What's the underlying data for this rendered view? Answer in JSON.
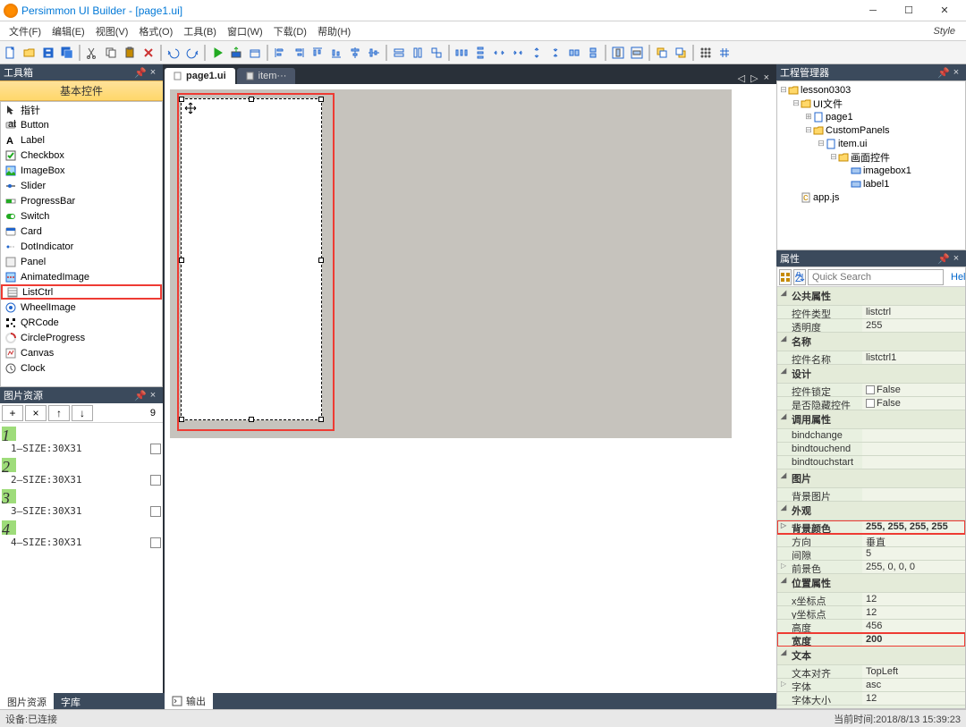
{
  "window": {
    "title": "Persimmon UI Builder - [page1.ui]"
  },
  "menu": [
    "文件(F)",
    "编辑(E)",
    "视图(V)",
    "格式(O)",
    "工具(B)",
    "窗口(W)",
    "下载(D)",
    "帮助(H)"
  ],
  "style_label": "Style",
  "toolbox": {
    "title": "工具箱",
    "section": "基本控件",
    "items": [
      "指针",
      "Button",
      "Label",
      "Checkbox",
      "ImageBox",
      "Slider",
      "ProgressBar",
      "Switch",
      "Card",
      "DotIndicator",
      "Panel",
      "AnimatedImage",
      "ListCtrl",
      "WheelImage",
      "QRCode",
      "CircleProgress",
      "Canvas",
      "Clock"
    ],
    "highlight": "ListCtrl"
  },
  "img_res": {
    "title": "图片资源",
    "count": "9",
    "items": [
      {
        "num": "1",
        "label": "1—SIZE:30X31"
      },
      {
        "num": "2",
        "label": "2—SIZE:30X31"
      },
      {
        "num": "3",
        "label": "3—SIZE:30X31"
      },
      {
        "num": "4",
        "label": "4—SIZE:30X31"
      }
    ],
    "tab_active": "图片资源",
    "tab_other": "字库"
  },
  "doc_tabs": {
    "active": "page1.ui",
    "other": "item···"
  },
  "project": {
    "title": "工程管理器",
    "tree": [
      {
        "depth": 0,
        "exp": "⊟",
        "icon": "folder",
        "label": "lesson0303"
      },
      {
        "depth": 1,
        "exp": "⊟",
        "icon": "folder",
        "label": "UI文件"
      },
      {
        "depth": 2,
        "exp": "⊞",
        "icon": "page",
        "label": "page1"
      },
      {
        "depth": 2,
        "exp": "⊟",
        "icon": "folder",
        "label": "CustomPanels"
      },
      {
        "depth": 3,
        "exp": "⊟",
        "icon": "page",
        "label": "item.ui"
      },
      {
        "depth": 4,
        "exp": "⊟",
        "icon": "folder",
        "label": "画面控件"
      },
      {
        "depth": 5,
        "exp": "",
        "icon": "ctrl",
        "label": "imagebox1"
      },
      {
        "depth": 5,
        "exp": "",
        "icon": "ctrl",
        "label": "label1"
      },
      {
        "depth": 1,
        "exp": "",
        "icon": "js",
        "label": "app.js"
      }
    ]
  },
  "props": {
    "title": "属性",
    "search_placeholder": "Quick Search",
    "help": "Help",
    "rows": [
      {
        "t": "cat",
        "label": "公共属性"
      },
      {
        "t": "row",
        "k": "控件类型",
        "v": "listctrl"
      },
      {
        "t": "row",
        "k": "透明度",
        "v": "255"
      },
      {
        "t": "cat",
        "label": "名称"
      },
      {
        "t": "row",
        "k": "控件名称",
        "v": "listctrl1"
      },
      {
        "t": "cat",
        "label": "设计"
      },
      {
        "t": "row",
        "k": "控件锁定",
        "v": "False",
        "cb": true
      },
      {
        "t": "row",
        "k": "是否隐藏控件",
        "v": "False",
        "cb": true
      },
      {
        "t": "cat",
        "label": "调用属性"
      },
      {
        "t": "row",
        "k": "bindchange",
        "v": ""
      },
      {
        "t": "row",
        "k": "bindtouchend",
        "v": ""
      },
      {
        "t": "row",
        "k": "bindtouchstart",
        "v": ""
      },
      {
        "t": "cat",
        "label": "图片"
      },
      {
        "t": "row",
        "k": "背景图片",
        "v": ""
      },
      {
        "t": "cat",
        "label": "外观"
      },
      {
        "t": "row",
        "k": "背景颜色",
        "v": "255, 255, 255, 255",
        "hl": true,
        "exp": true
      },
      {
        "t": "row",
        "k": "方向",
        "v": "垂直"
      },
      {
        "t": "row",
        "k": "间隙",
        "v": "5"
      },
      {
        "t": "row",
        "k": "前景色",
        "v": "255, 0, 0, 0",
        "exp": true
      },
      {
        "t": "cat",
        "label": "位置属性"
      },
      {
        "t": "row",
        "k": "x坐标点",
        "v": "12"
      },
      {
        "t": "row",
        "k": "y坐标点",
        "v": "12"
      },
      {
        "t": "row",
        "k": "高度",
        "v": "456"
      },
      {
        "t": "row",
        "k": "宽度",
        "v": "200",
        "hl": true
      },
      {
        "t": "cat",
        "label": "文本"
      },
      {
        "t": "row",
        "k": "文本对齐",
        "v": "TopLeft"
      },
      {
        "t": "row",
        "k": "字体",
        "v": "asc",
        "exp": true
      },
      {
        "t": "row",
        "k": "字体大小",
        "v": "12"
      }
    ]
  },
  "output_tab": "输出",
  "status": {
    "left": "设备:已连接",
    "right": "当前时间:2018/8/13 15:39:23"
  }
}
